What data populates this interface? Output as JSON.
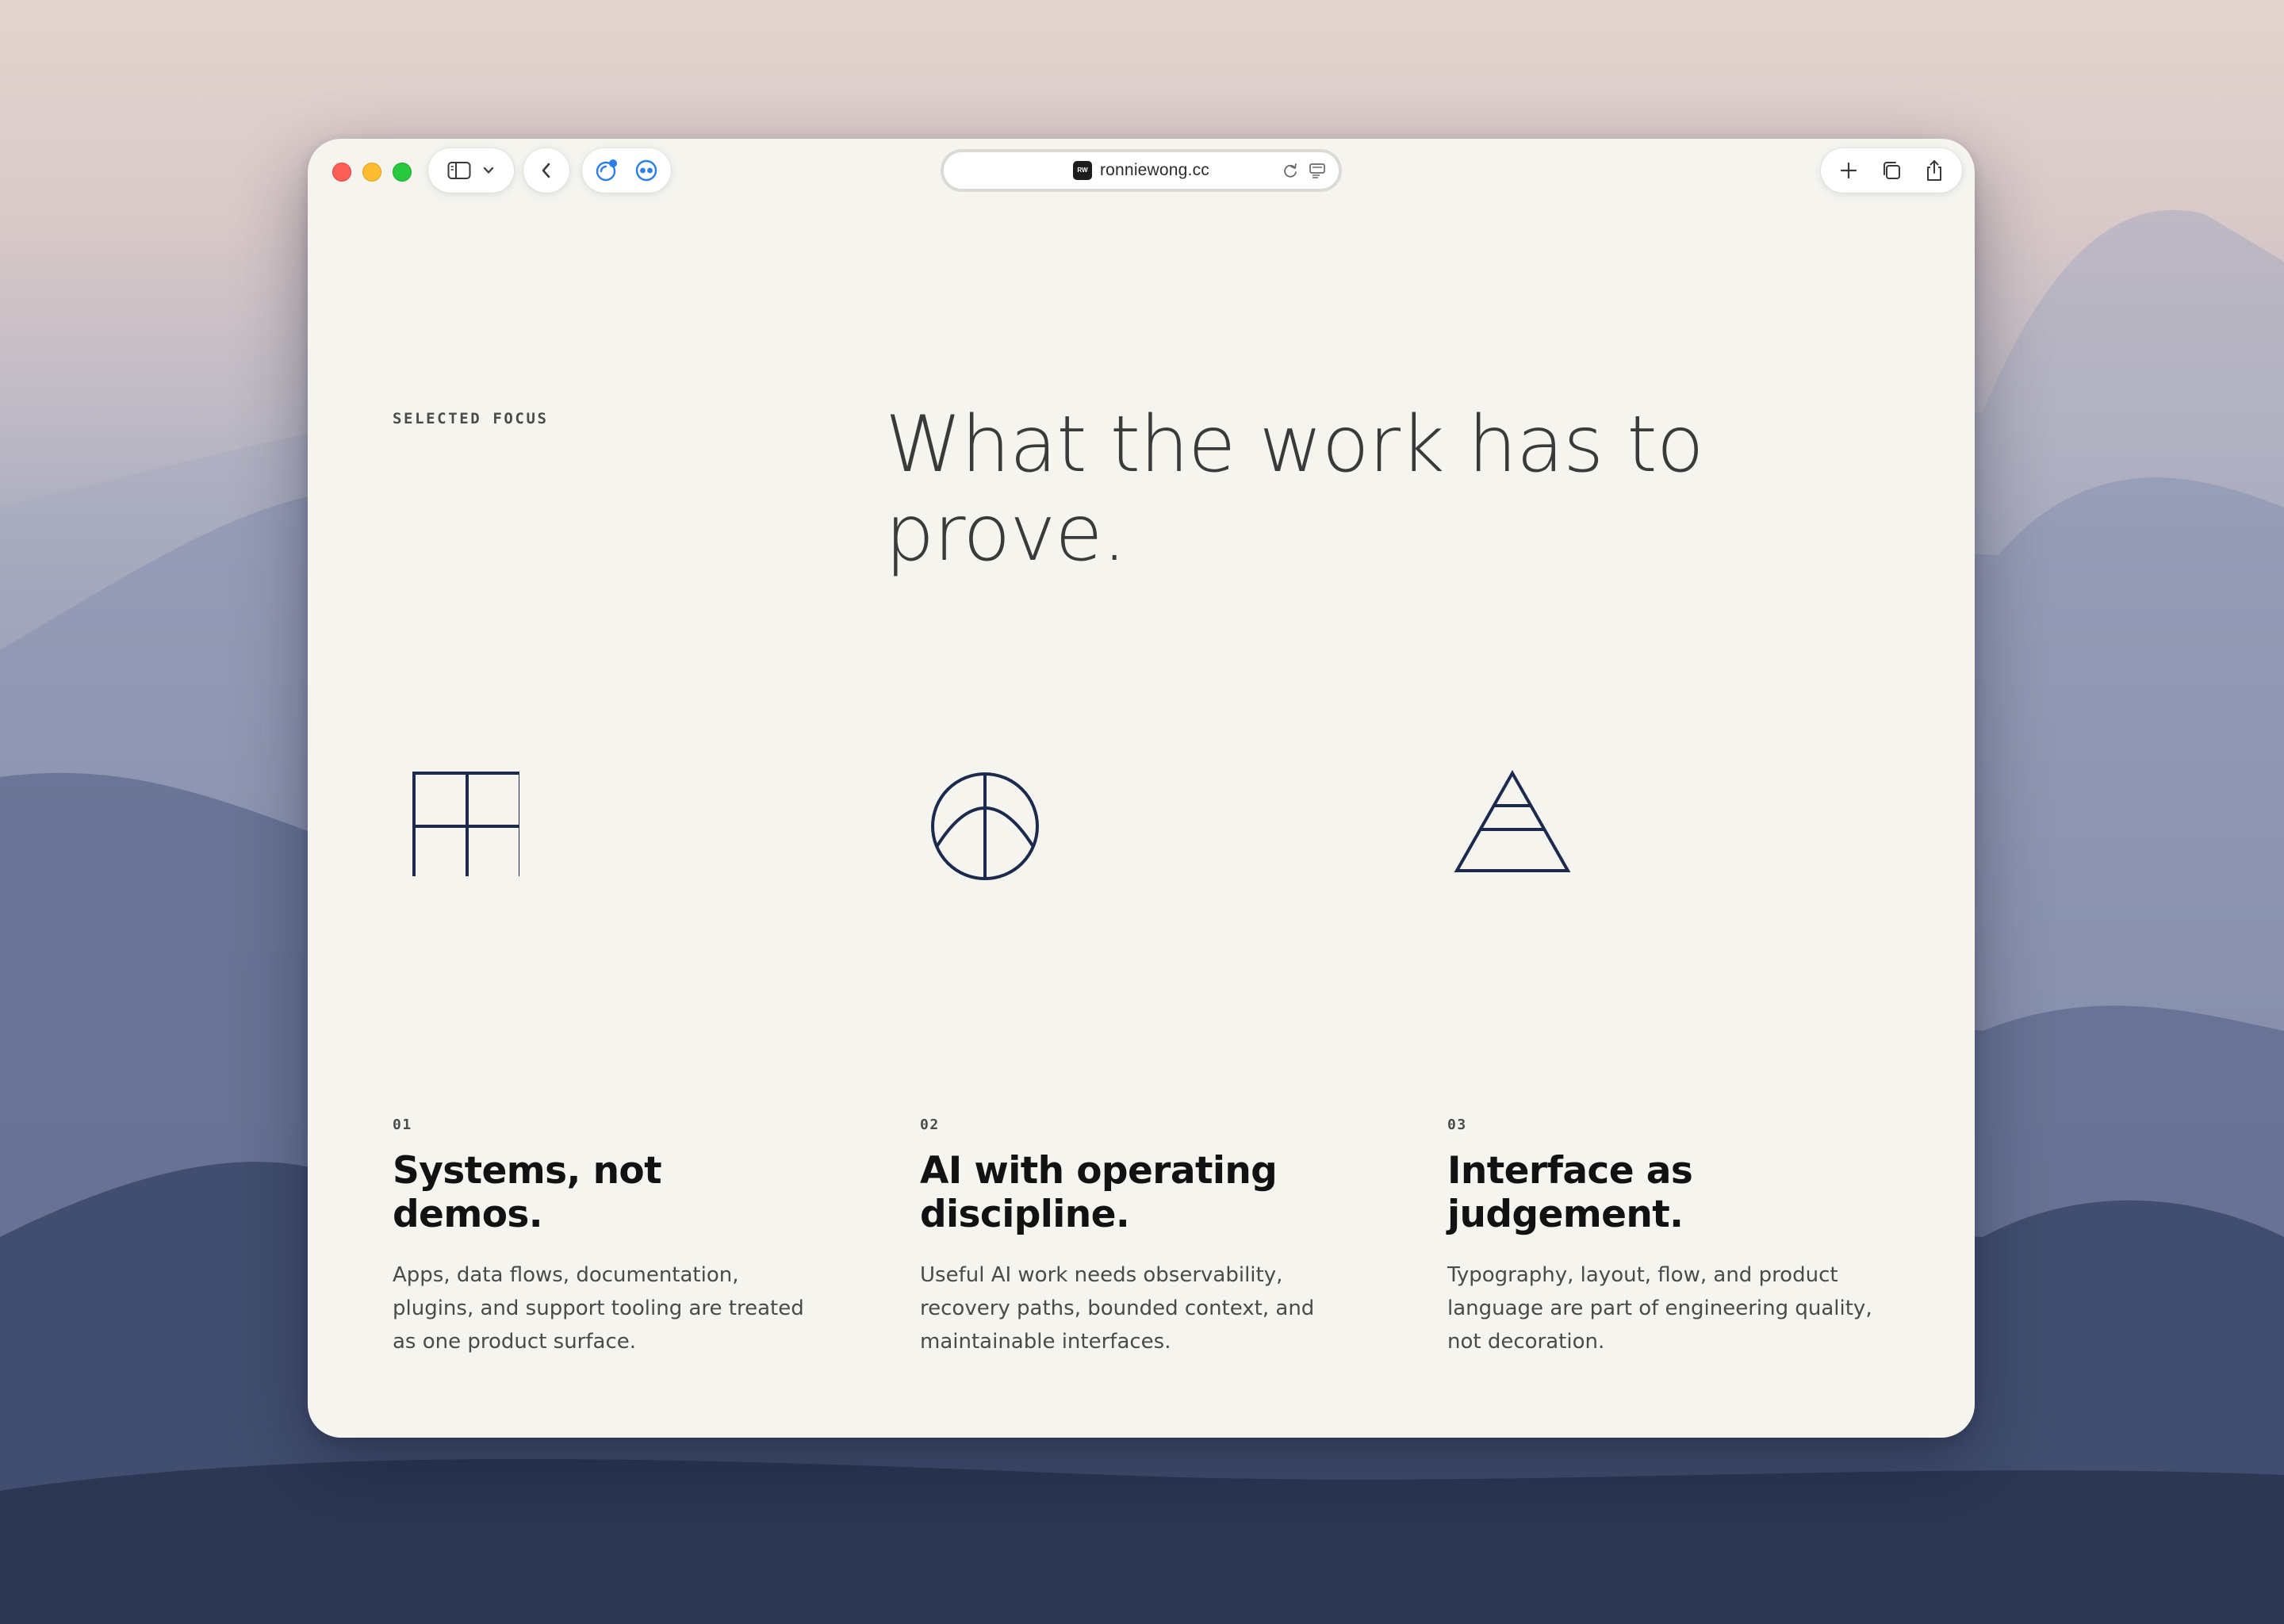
{
  "browser": {
    "url": "ronniewong.cc",
    "favicon_label": "RW",
    "icons": [
      "sidebar-icon",
      "chevron-down-icon",
      "back-icon",
      "extension-icon",
      "extension-icon",
      "refresh-icon",
      "reader-icon",
      "plus-icon",
      "tabs-icon",
      "share-icon"
    ]
  },
  "section": {
    "eyebrow": "SELECTED FOCUS",
    "headline": "What the work has to prove."
  },
  "cards": [
    {
      "icon": "grid-icon",
      "number": "01",
      "title": "Systems, not demos.",
      "body": "Apps, data flows, documentation, plugins, and support tooling are treated as one product surface."
    },
    {
      "icon": "circle-arc-icon",
      "number": "02",
      "title": "AI with operating discipline.",
      "body": "Useful AI work needs observability, recovery paths, bounded context, and maintainable interfaces."
    },
    {
      "icon": "pyramid-icon",
      "number": "03",
      "title": "Interface as judgement.",
      "body": "Typography, layout, flow, and product language are part of engineering quality, not decoration."
    }
  ],
  "colors": {
    "page_background": "#f5f4ef",
    "icon_stroke": "#1c2b4d",
    "heading_text": "#121212",
    "body_text": "#4a4a4a"
  }
}
